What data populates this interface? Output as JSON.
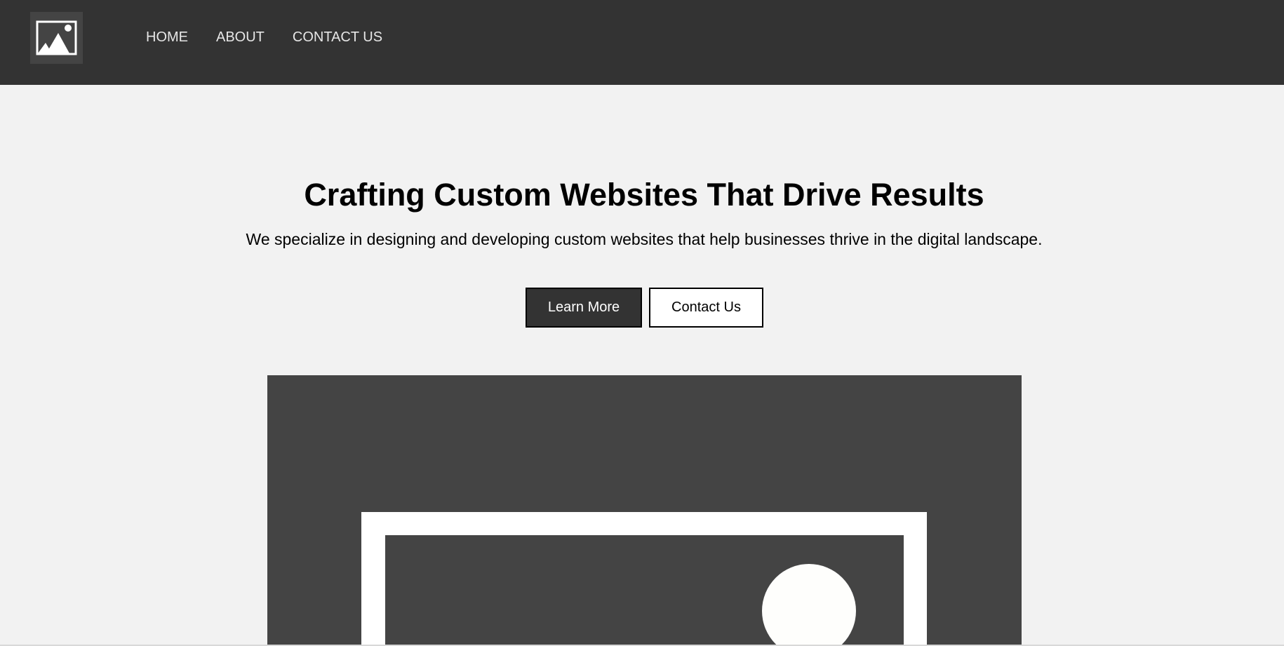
{
  "nav": {
    "logo_icon": "image-placeholder-icon",
    "items": [
      {
        "label": "HOME"
      },
      {
        "label": "ABOUT"
      },
      {
        "label": "CONTACT US"
      }
    ]
  },
  "hero": {
    "title": "Crafting Custom Websites That Drive Results",
    "subtitle": "We specialize in designing and developing custom websites that help businesses thrive in the digital landscape.",
    "primary_button": "Learn More",
    "secondary_button": "Contact Us",
    "image_icon": "image-placeholder-icon"
  },
  "colors": {
    "navbar": "#333333",
    "page_background": "#f2f2f2",
    "image_background": "#444444",
    "primary_button": "#333333"
  }
}
